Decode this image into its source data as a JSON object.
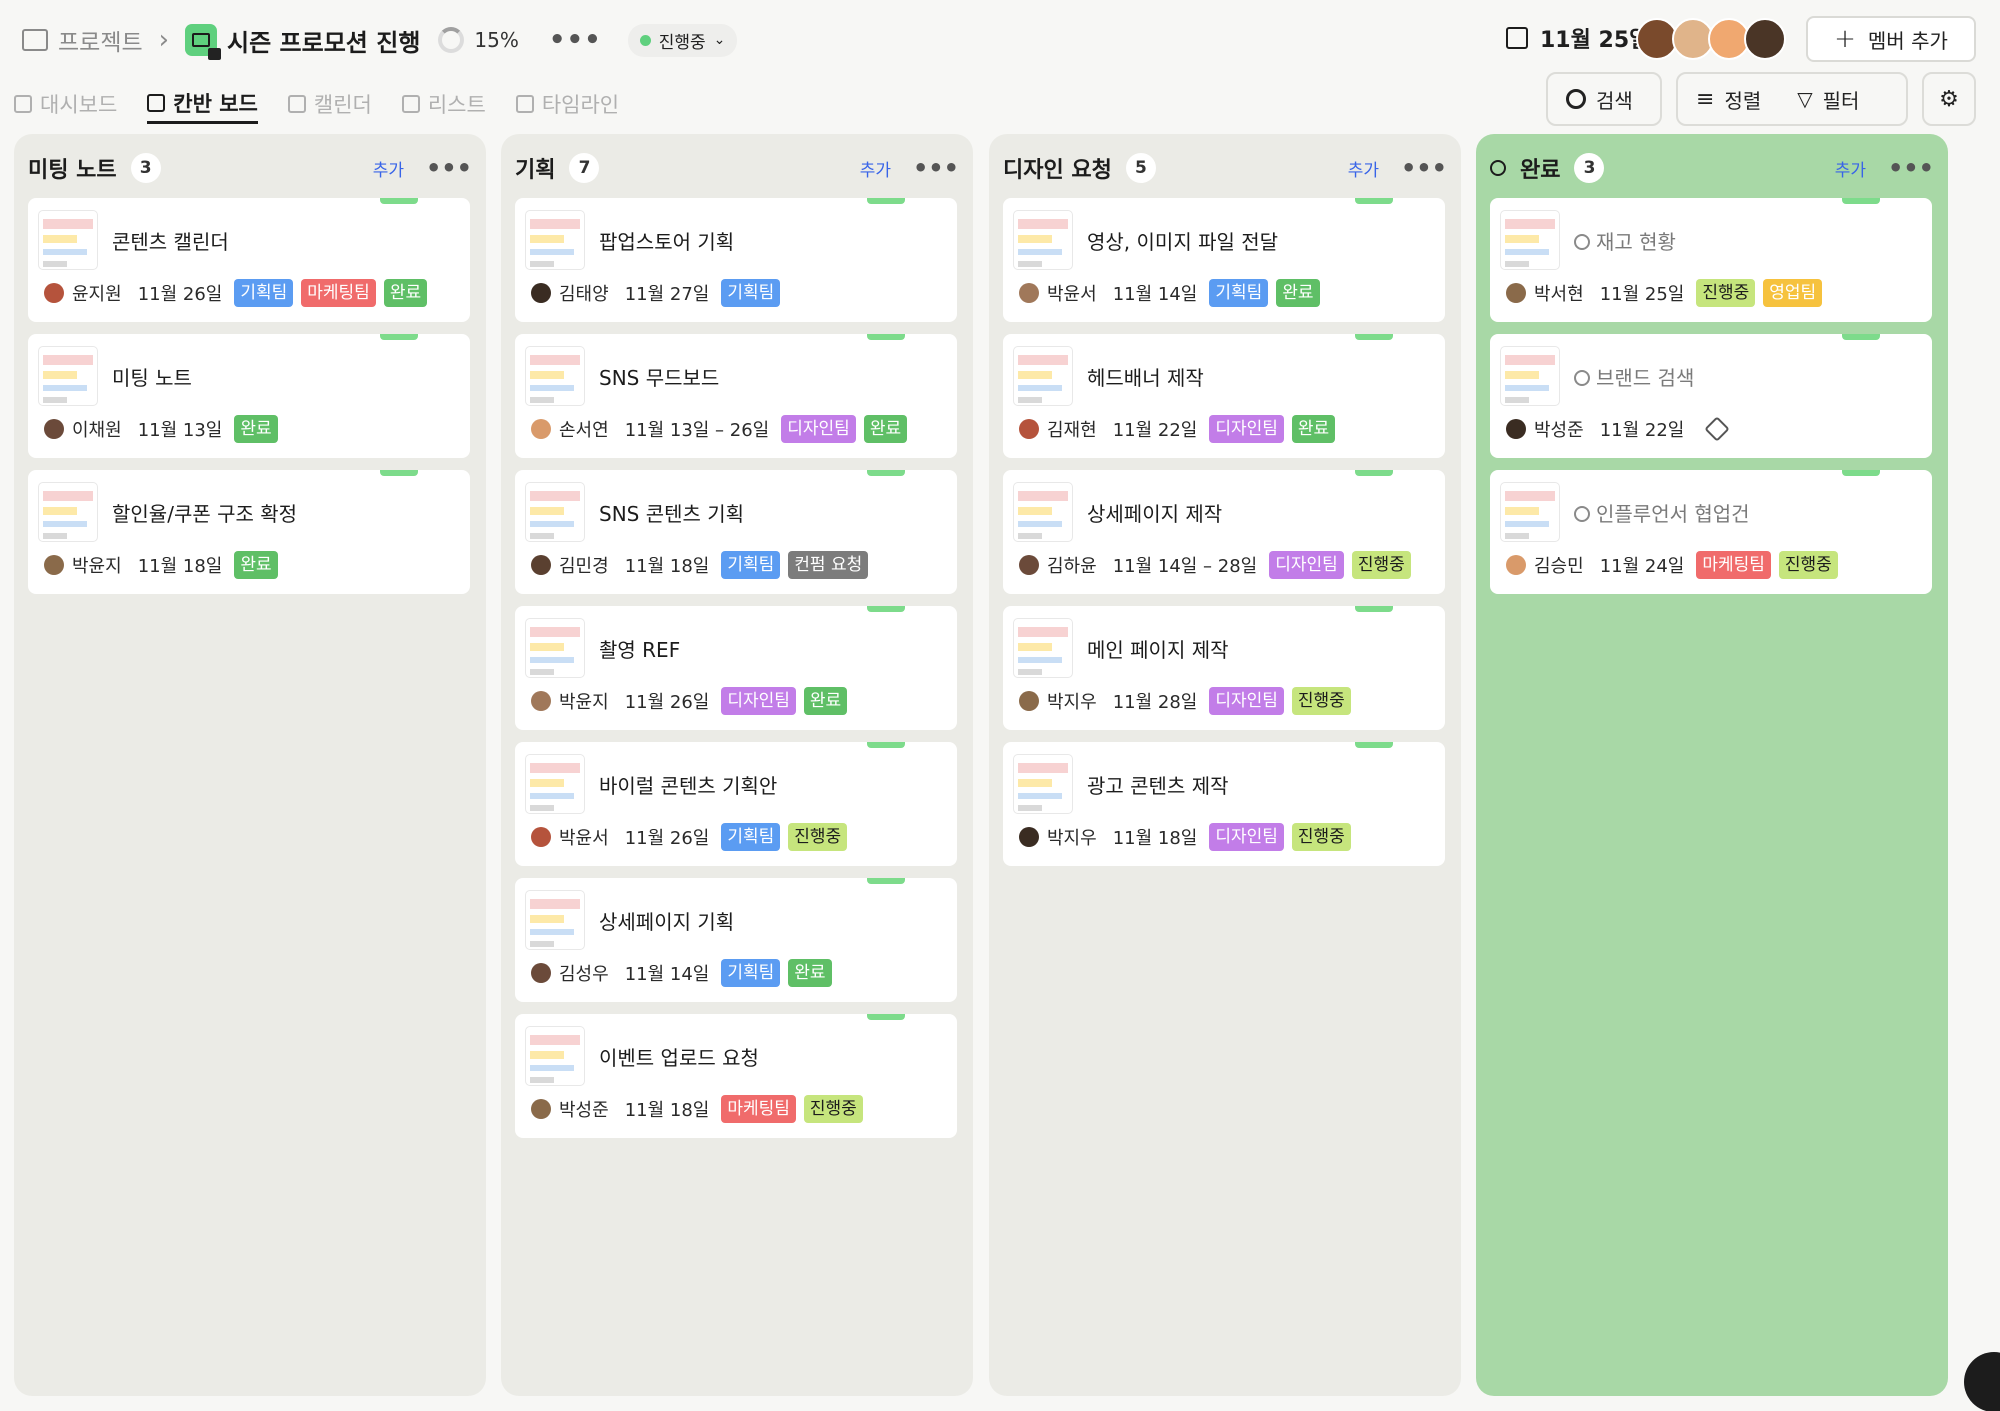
{
  "header": {
    "breadcrumb_root": "프로젝트",
    "project_title": "시즌 프로모션 진행",
    "progress_label": "15%",
    "progress": 0.15,
    "status": "진행중",
    "date": "11월 25일",
    "add_member_label": "멤버 추가"
  },
  "view_tabs": [
    {
      "label": "대시보드"
    },
    {
      "label": "칸반 보드",
      "active": true
    },
    {
      "label": "캘린더"
    },
    {
      "label": "리스트"
    },
    {
      "label": "타임라인"
    }
  ],
  "tools": {
    "search": "검색",
    "sort": "정렬",
    "filter": "필터"
  },
  "avatars": [
    {
      "color": "#7a4a2c"
    },
    {
      "color": "#e0b48a"
    },
    {
      "color": "#f0a870"
    },
    {
      "color": "#4a3526"
    }
  ],
  "add_label": "추가",
  "tag_colors": {
    "기획팀": "plan",
    "마케팅팀": "mkt",
    "완료": "done",
    "디자인팀": "design",
    "진행중": "prog",
    "영업팀": "sales",
    "컨펌 요청": "content"
  },
  "columns": [
    {
      "title": "미팅 노트",
      "count": "3",
      "done": false,
      "cards": [
        {
          "title": "콘텐츠 캘린더",
          "assignee": "윤지원",
          "date": "11월 26일",
          "tags": [
            "기획팀",
            "마케팅팀",
            "완료"
          ]
        },
        {
          "title": "미팅 노트",
          "assignee": "이채원",
          "date": "11월 13일",
          "tags": [
            "완료"
          ]
        },
        {
          "title": "할인율/쿠폰 구조 확정",
          "assignee": "박윤지",
          "date": "11월 18일",
          "tags": [
            "완료"
          ]
        }
      ]
    },
    {
      "title": "기획",
      "count": "7",
      "done": false,
      "cards": [
        {
          "title": "팝업스토어 기획",
          "assignee": "김태양",
          "date": "11월 27일",
          "tags": [
            "기획팀"
          ]
        },
        {
          "title": "SNS 무드보드",
          "assignee": "손서연",
          "date": "11월 13일 – 26일",
          "tags": [
            "디자인팀",
            "완료"
          ]
        },
        {
          "title": "SNS 콘텐츠 기획",
          "assignee": "김민경",
          "date": "11월 18일",
          "tags": [
            "기획팀",
            "컨펌 요청"
          ]
        },
        {
          "title": "촬영 REF",
          "assignee": "박윤지",
          "date": "11월 26일",
          "tags": [
            "디자인팀",
            "완료"
          ]
        },
        {
          "title": "바이럴 콘텐츠 기획안",
          "assignee": "박윤서",
          "date": "11월 26일",
          "tags": [
            "기획팀",
            "진행중"
          ]
        },
        {
          "title": "상세페이지 기획",
          "assignee": "김성우",
          "date": "11월 14일",
          "tags": [
            "기획팀",
            "완료"
          ]
        },
        {
          "title": "이벤트 업로드 요청",
          "assignee": "박성준",
          "date": "11월 18일",
          "tags": [
            "마케팅팀",
            "진행중"
          ]
        }
      ]
    },
    {
      "title": "디자인 요청",
      "count": "5",
      "done": false,
      "cards": [
        {
          "title": "영상, 이미지 파일 전달",
          "assignee": "박윤서",
          "date": "11월 14일",
          "tags": [
            "기획팀",
            "완료"
          ]
        },
        {
          "title": "헤드배너 제작",
          "assignee": "김재현",
          "date": "11월 22일",
          "tags": [
            "디자인팀",
            "완료"
          ]
        },
        {
          "title": "상세페이지 제작",
          "assignee": "김하윤",
          "date": "11월 14일 – 28일",
          "tags": [
            "디자인팀",
            "진행중"
          ]
        },
        {
          "title": "메인 페이지 제작",
          "assignee": "박지우",
          "date": "11월 28일",
          "tags": [
            "디자인팀",
            "진행중"
          ]
        },
        {
          "title": "광고 콘텐츠 제작",
          "assignee": "박지우",
          "date": "11월 18일",
          "tags": [
            "디자인팀",
            "진행중"
          ]
        }
      ]
    },
    {
      "title": "완료",
      "count": "3",
      "done": true,
      "cards": [
        {
          "title": "재고 현황",
          "assignee": "박서현",
          "date": "11월 25일",
          "tags": [
            "진행중",
            "영업팀"
          ]
        },
        {
          "title": "브랜드 검색",
          "assignee": "박성준",
          "date": "11월 22일",
          "tags": [],
          "tag_icon": true
        },
        {
          "title": "인플루언서 협업건",
          "assignee": "김승민",
          "date": "11월 24일",
          "tags": [
            "마케팅팀",
            "진행중"
          ]
        }
      ]
    }
  ]
}
